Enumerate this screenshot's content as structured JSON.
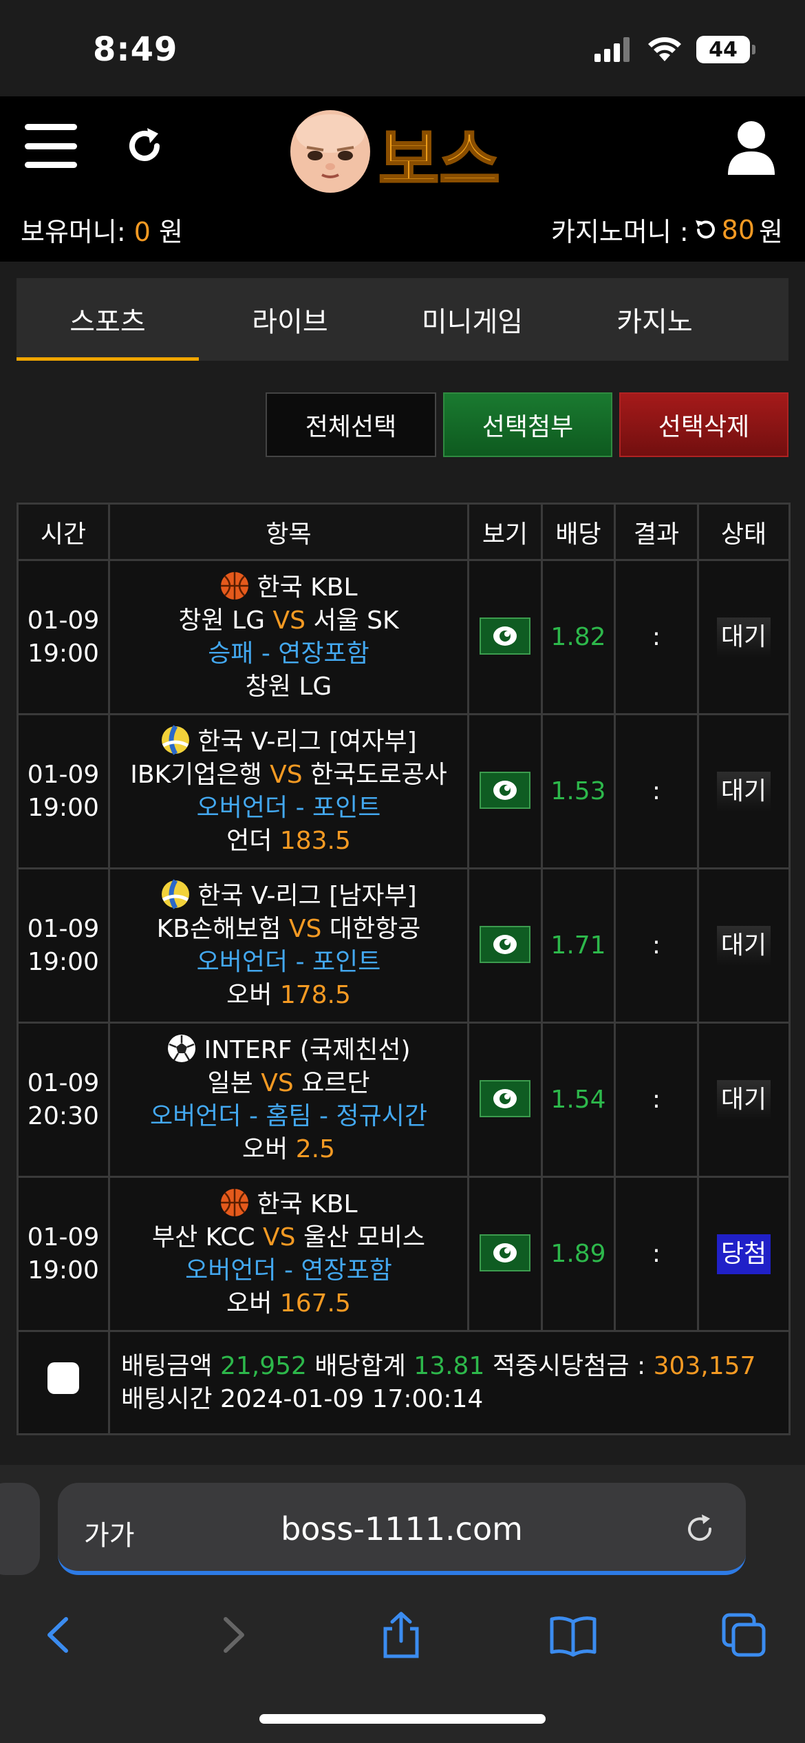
{
  "status_bar": {
    "time": "8:49",
    "battery": "44"
  },
  "header": {
    "logo_text": "보스",
    "money_label": "보유머니:",
    "money_value": "0",
    "money_unit": "원",
    "casino_label": "카지노머니 :",
    "casino_value": "80",
    "casino_unit": "원"
  },
  "tabs": [
    {
      "label": "스포츠"
    },
    {
      "label": "라이브"
    },
    {
      "label": "미니게임"
    },
    {
      "label": "카지노"
    }
  ],
  "actions": {
    "select_all": "전체선택",
    "attach": "선택첨부",
    "delete": "선택삭제"
  },
  "table": {
    "headers": {
      "time": "시간",
      "item": "항목",
      "view": "보기",
      "odds": "배당",
      "result": "결과",
      "status": "상태"
    },
    "rows": [
      {
        "date": "01-09",
        "time": "19:00",
        "sport": "basketball",
        "league": "한국 KBL",
        "home": "창원 LG",
        "vs": "VS",
        "away": "서울 SK",
        "market": "승패 - 연장포함",
        "pick_label": "창원 LG",
        "pick_value": "",
        "odds": "1.82",
        "result": ":",
        "status": "대기"
      },
      {
        "date": "01-09",
        "time": "19:00",
        "sport": "volleyball",
        "league": "한국 V-리그 [여자부]",
        "home": "IBK기업은행",
        "vs": "VS",
        "away": "한국도로공사",
        "market": "오버언더 - 포인트",
        "pick_label": "언더",
        "pick_value": "183.5",
        "odds": "1.53",
        "result": ":",
        "status": "대기"
      },
      {
        "date": "01-09",
        "time": "19:00",
        "sport": "volleyball",
        "league": "한국 V-리그 [남자부]",
        "home": "KB손해보험",
        "vs": "VS",
        "away": "대한항공",
        "market": "오버언더 - 포인트",
        "pick_label": "오버",
        "pick_value": "178.5",
        "odds": "1.71",
        "result": ":",
        "status": "대기"
      },
      {
        "date": "01-09",
        "time": "20:30",
        "sport": "soccer",
        "league": "INTERF (국제친선)",
        "home": "일본",
        "vs": "VS",
        "away": "요르단",
        "market": "오버언더 - 홈팀 - 정규시간",
        "pick_label": "오버",
        "pick_value": "2.5",
        "odds": "1.54",
        "result": ":",
        "status": "대기"
      },
      {
        "date": "01-09",
        "time": "19:00",
        "sport": "basketball",
        "league": "한국 KBL",
        "home": "부산 KCC",
        "vs": "VS",
        "away": "울산 모비스",
        "market": "오버언더 - 연장포함",
        "pick_label": "오버",
        "pick_value": "167.5",
        "odds": "1.89",
        "result": ":",
        "status": "당첨"
      }
    ],
    "summary": {
      "amount_label": "배팅금액",
      "amount": "21,952",
      "odds_label": "배당합계",
      "odds_total": "13.81",
      "payout_label": "적중시당첨금 :",
      "payout": "303,157",
      "time_label": "배팅시간",
      "time": "2024-01-09 17:00:14"
    }
  },
  "browser": {
    "aa": "가가",
    "url": "boss-1111.com"
  },
  "colors": {
    "accent": "#f59a23",
    "odds": "#2db84b",
    "market": "#43a8f0",
    "win": "#2020c8"
  }
}
